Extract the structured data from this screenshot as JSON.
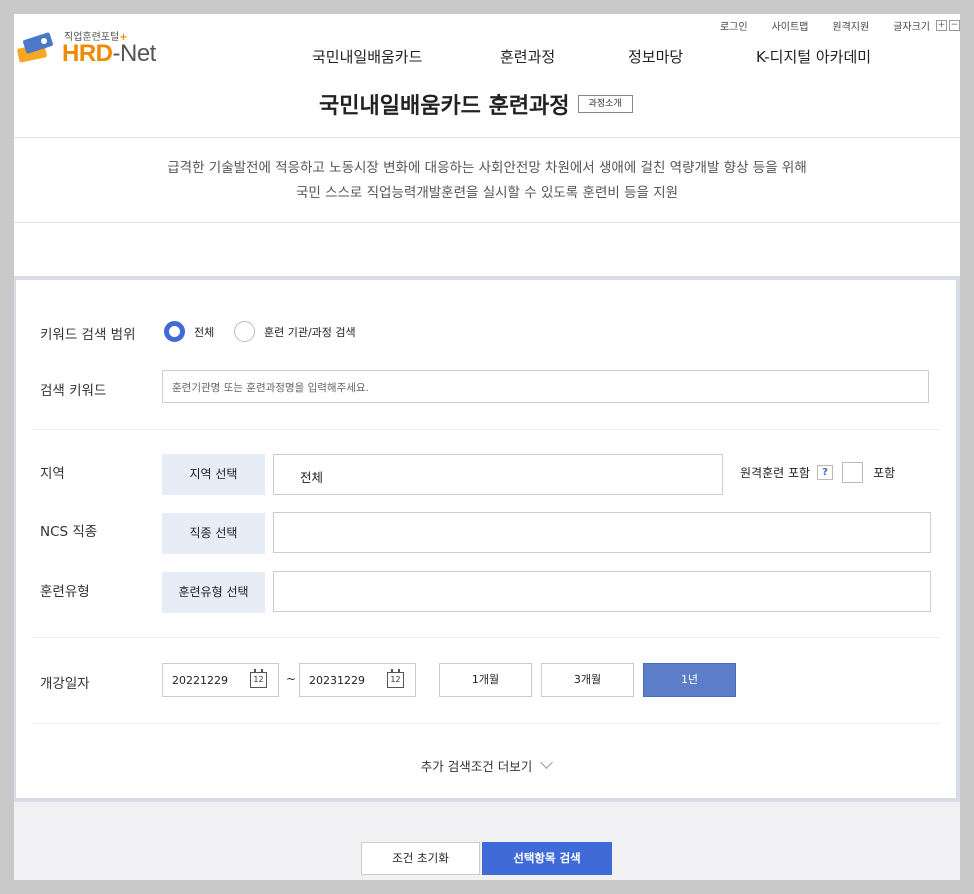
{
  "header": {
    "utility": [
      "로그인",
      "사이트맵",
      "원격지원"
    ],
    "font_size_label": "글자크기",
    "zoom_in": "+",
    "zoom_out": "−",
    "logo_small": "직업훈련포털",
    "logo_plus": "+",
    "logo_hrd": "HRD",
    "logo_dash": "-",
    "logo_net": "Net",
    "gnb": [
      "국민내일배움카드",
      "훈련과정",
      "정보마당",
      "K-디지털 아카데미"
    ]
  },
  "page": {
    "title": "국민내일배움카드 훈련과정",
    "intro_button": "과정소개",
    "desc_line1": "급격한 기술발전에 적응하고 노동시장 변화에 대응하는 사회안전망 차원에서 생애에 걸친 역량개발 향상 등을 위해",
    "desc_line2": "국민 스스로 직업능력개발훈련을 실시할 수 있도록 훈련비 등을 지원"
  },
  "search": {
    "keyword_scope_label": "키워드 검색 범위",
    "scope_options": [
      "전체",
      "훈련 기관/과정 검색"
    ],
    "scope_selected": "전체",
    "keyword_label": "검색 키워드",
    "keyword_placeholder": "훈련기관명 또는 훈련과정명을 입력해주세요.",
    "region_label": "지역",
    "region_button": "지역 선택",
    "region_value": "전체",
    "remote_label": "원격훈련 포함",
    "remote_help": "?",
    "remote_checkbox_label": "포함",
    "ncs_label": "NCS 직종",
    "ncs_button": "직종 선택",
    "ncs_value": "",
    "type_label": "훈련유형",
    "type_button": "훈련유형 선택",
    "type_value": "",
    "date_label": "개강일자",
    "date_start": "20221229",
    "date_end": "20231229",
    "date_sep": "~",
    "calendar_day": "12",
    "periods": [
      "1개월",
      "3개월",
      "1년"
    ],
    "period_selected": "1년",
    "more_label": "추가 검색조건 더보기"
  },
  "actions": {
    "reset": "조건 초기화",
    "search": "선택항목 검색"
  },
  "colors": {
    "accent": "#3f6ad8",
    "selected_period": "#5c7ec8",
    "logo_orange": "#f08a00",
    "button_bg": "#e7edf7"
  }
}
